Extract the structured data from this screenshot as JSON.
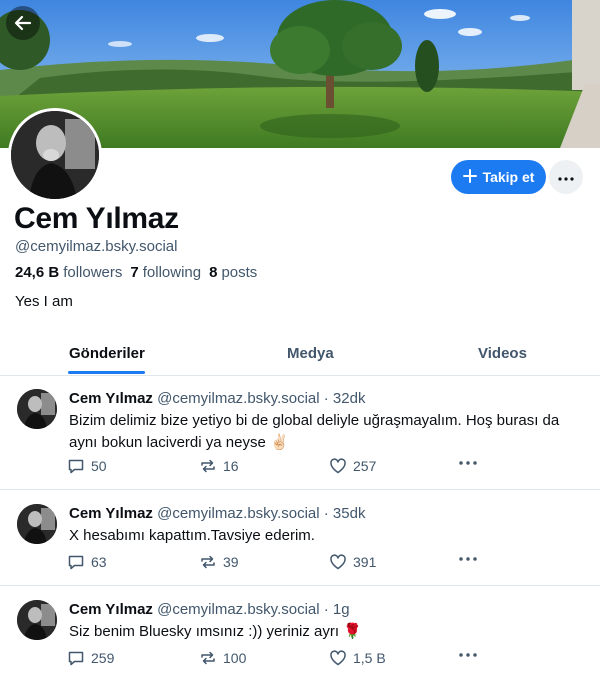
{
  "profile": {
    "display_name": "Cem Yılmaz",
    "handle": "@cemyilmaz.bsky.social",
    "followers_count": "24,6 B",
    "followers_label": "followers",
    "following_count": "7",
    "following_label": "following",
    "posts_count": "8",
    "posts_label": "posts",
    "bio": "Yes I am"
  },
  "actions": {
    "follow_label": "Takip et"
  },
  "tabs": [
    {
      "label": "Gönderiler",
      "active": true
    },
    {
      "label": "Medya",
      "active": false
    },
    {
      "label": "Videos",
      "active": false
    }
  ],
  "posts": [
    {
      "name": "Cem Yılmaz",
      "handle": "@cemyilmaz.bsky.social",
      "time": "· 32dk",
      "text": "Bizim delimiz bize yetiyo bi de global deliyle uğraşmayalım. Hoş burası da aynı bokun laciverdi ya neyse ✌🏻",
      "replies": "50",
      "reposts": "16",
      "likes": "257"
    },
    {
      "name": "Cem Yılmaz",
      "handle": "@cemyilmaz.bsky.social",
      "time": "· 35dk",
      "text": "X hesabımı kapattım.Tavsiye ederim.",
      "replies": "63",
      "reposts": "39",
      "likes": "391"
    },
    {
      "name": "Cem Yılmaz",
      "handle": "@cemyilmaz.bsky.social",
      "time": "· 1g",
      "text": "Siz benim Bluesky ımsınız :)) yeriniz ayrı 🌹",
      "replies": "259",
      "reposts": "100",
      "likes": "1,5 B"
    }
  ],
  "icons": {
    "back": "arrow-left-icon",
    "follow": "plus-icon",
    "more": "ellipsis-icon",
    "reply": "speech-bubble-icon",
    "repost": "repost-arrows-icon",
    "like": "heart-icon",
    "post_menu": "ellipsis-icon"
  },
  "colors": {
    "accent": "#1d7bf2",
    "muted_text": "#42576c",
    "divider": "#e1e6ea"
  }
}
